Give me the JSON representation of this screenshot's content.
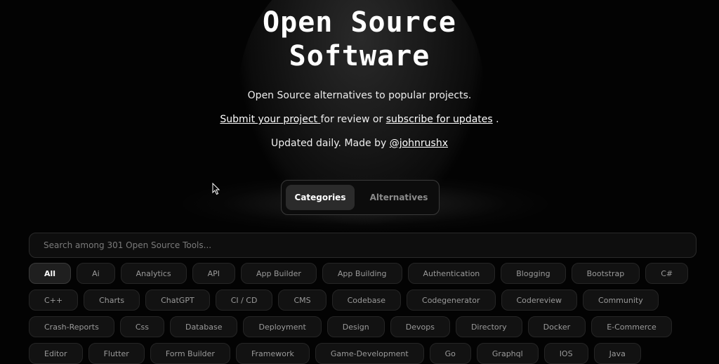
{
  "hero": {
    "title_line1": "Open Source",
    "title_line2": "Software",
    "tagline": "Open Source alternatives to popular projects.",
    "submit_link": "Submit your project ",
    "submit_middle": "for review or ",
    "subscribe_link": "subscribe for updates",
    "submit_end": " .",
    "updated_prefix": "Updated daily. Made by ",
    "author_link": "@johnrushx"
  },
  "toggle": {
    "categories_label": "Categories",
    "alternatives_label": "Alternatives",
    "selected": "Categories"
  },
  "search": {
    "placeholder": "Search among 301 Open Source Tools..."
  },
  "categories": [
    "All",
    "Ai",
    "Analytics",
    "API",
    "App Builder",
    "App Building",
    "Authentication",
    "Blogging",
    "Bootstrap",
    "C#",
    "C++",
    "Charts",
    "ChatGPT",
    "CI / CD",
    "CMS",
    "Codebase",
    "Codegenerator",
    "Codereview",
    "Community",
    "Crash-Reports",
    "Css",
    "Database",
    "Deployment",
    "Design",
    "Devops",
    "Directory",
    "Docker",
    "E-Commerce",
    "Editor",
    "Flutter",
    "Form Builder",
    "Framework",
    "Game-Development",
    "Go",
    "Graphql",
    "IOS",
    "Java"
  ],
  "selected_category": "All",
  "colors": {
    "background": "#030303",
    "chip_bg": "#121212",
    "chip_text": "#9a9a9a",
    "active_text": "#ffffff"
  }
}
